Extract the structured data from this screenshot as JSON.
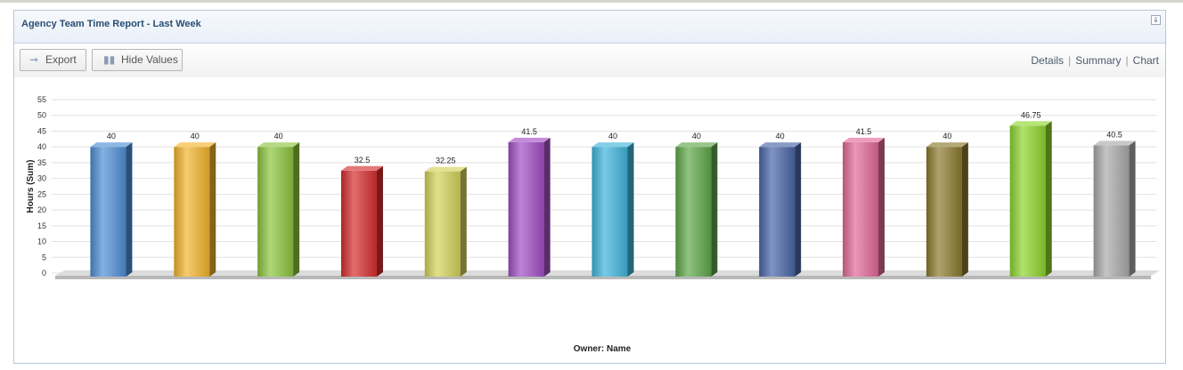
{
  "panel": {
    "title": "Agency Team Time Report - Last Week",
    "collapse_icon": "collapse-icon"
  },
  "toolbar": {
    "export_label": "Export",
    "hide_values_label": "Hide Values"
  },
  "views": {
    "details": "Details",
    "summary": "Summary",
    "chart": "Chart",
    "separator": "|"
  },
  "chart_data": {
    "type": "bar",
    "title": "",
    "xlabel": "Owner: Name",
    "ylabel": "Hours (Sum)",
    "ylim": [
      0,
      55
    ],
    "yticks": [
      0,
      5,
      10,
      15,
      20,
      25,
      30,
      35,
      40,
      45,
      50,
      55
    ],
    "grid": true,
    "style": "3d",
    "values": [
      40,
      40,
      40,
      32.5,
      32.25,
      41.5,
      40,
      40,
      40,
      41.5,
      40,
      46.75,
      40.5
    ],
    "value_labels": [
      "40",
      "40",
      "40",
      "32.5",
      "32.25",
      "41.5",
      "40",
      "40",
      "40",
      "41.5",
      "40",
      "46.75",
      "40.5"
    ],
    "colors": [
      "#4f8fd6",
      "#f2b52e",
      "#8dc63f",
      "#d62e2e",
      "#d3d35a",
      "#a24fc4",
      "#3fb5dc",
      "#5fa84a",
      "#4a66a8",
      "#e36a98",
      "#8c7a2e",
      "#8fd62e",
      "#aaaaaa"
    ]
  }
}
